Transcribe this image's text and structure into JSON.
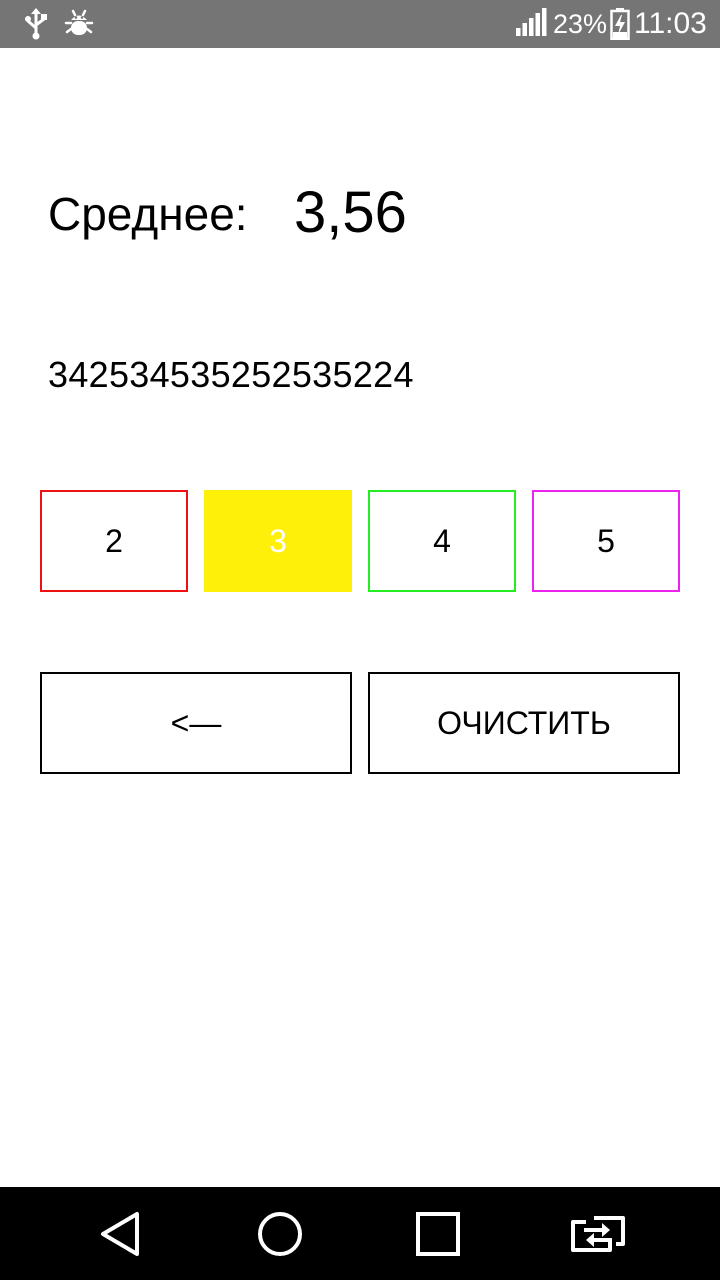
{
  "status_bar": {
    "battery_percent": "23%",
    "time": "11:03",
    "icons": [
      "usb-icon",
      "bug-icon",
      "signal-icon",
      "battery-charging-icon"
    ]
  },
  "main": {
    "average_label": "Среднее:",
    "average_value": "3,56",
    "grades_string": "342534535252535224"
  },
  "grade_buttons": [
    {
      "label": "2",
      "color": "#ee1111"
    },
    {
      "label": "3",
      "color": "#fff00a"
    },
    {
      "label": "4",
      "color": "#22ee22"
    },
    {
      "label": "5",
      "color": "#ee22ee"
    }
  ],
  "actions": {
    "backspace_label": "<—",
    "clear_label": "ОЧИСТИТЬ"
  },
  "nav_bar": {
    "icons": [
      "back-icon",
      "home-icon",
      "recents-icon",
      "switch-app-icon"
    ]
  }
}
